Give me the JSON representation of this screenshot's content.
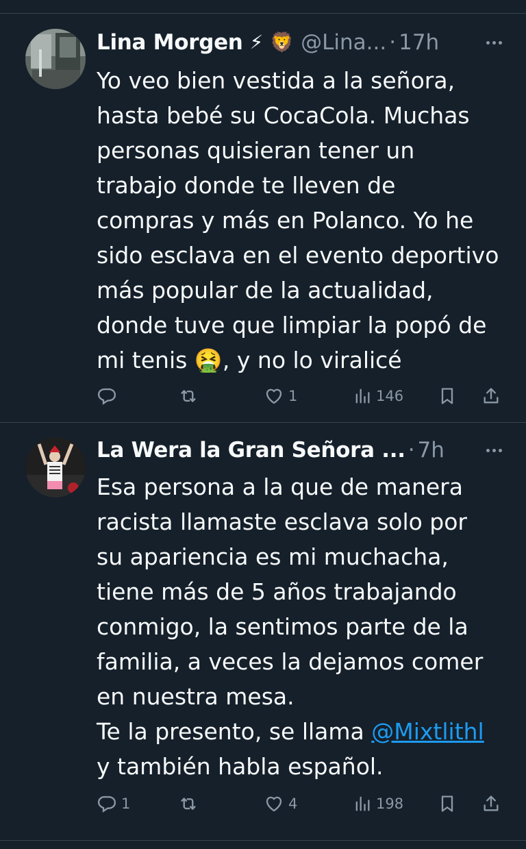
{
  "tweets": [
    {
      "name": "Lina Morgen",
      "badges": [
        "⚡",
        "🦁"
      ],
      "handle": "@Lina...",
      "dot": "·",
      "time": "17h",
      "body": "Yo veo bien vestida a la señora,\nhasta bebé su CocaCola. Muchas\npersonas quisieran tener un\ntrabajo donde te lleven de\ncompras y más en Polanco. Yo he\nsido esclava en el evento deportivo\nmás popular de la actualidad,\ndonde tuve que limpiar la popó de\nmi tenis 🤮, y no lo viralicé",
      "actions": {
        "replies": "",
        "retweets": "",
        "likes": "1",
        "views": "146"
      }
    },
    {
      "name": "La Wera la Gran Señora ...",
      "badges": [],
      "handle": "",
      "dot": "·",
      "time": "7h",
      "body_before_mention": "Esa persona a la que de manera\nracista llamaste esclava solo por\nsu apariencia es mi muchacha,\ntiene más de 5 años trabajando\nconmigo, la sentimos parte de la\nfamilia, a veces la dejamos comer\nen nuestra mesa.\nTe la presento, se llama ",
      "mention": "@Mixtlithl",
      "body_after_mention": "\ny también habla español.",
      "actions": {
        "replies": "1",
        "retweets": "",
        "likes": "4",
        "views": "198"
      }
    }
  ],
  "colors": {
    "background": "#15202b",
    "text": "#f7f9f9",
    "secondary": "#8b98a5",
    "link": "#1d9bf0",
    "divider": "#38444d"
  },
  "icons": [
    "reply-icon",
    "retweet-icon",
    "like-icon",
    "views-icon",
    "bookmark-icon",
    "share-icon",
    "more-icon"
  ]
}
